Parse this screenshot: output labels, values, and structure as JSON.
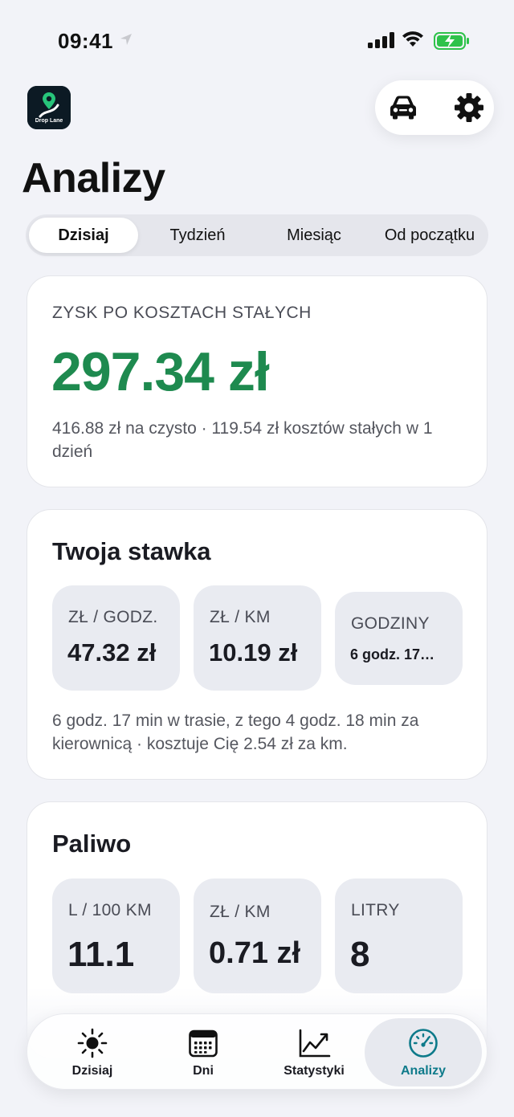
{
  "status_bar": {
    "time": "09:41"
  },
  "header": {
    "title": "Analizy"
  },
  "segments": [
    {
      "label": "Dzisiaj",
      "active": true
    },
    {
      "label": "Tydzień",
      "active": false
    },
    {
      "label": "Miesiąc",
      "active": false
    },
    {
      "label": "Od początku",
      "active": false
    }
  ],
  "profit": {
    "overline": "ZYSK PO KOSZTACH STAŁYCH",
    "value": "297.34 zł",
    "subtitle": "416.88 zł na czysto · 119.54 zł kosztów stałych w 1 dzień"
  },
  "rate": {
    "title": "Twoja stawka",
    "stats": [
      {
        "label": "ZŁ / GODZ.",
        "value": "47.32 zł"
      },
      {
        "label": "ZŁ / KM",
        "value": "10.19 zł"
      },
      {
        "label": "GODZINY",
        "value": "6 godz. 17…"
      }
    ],
    "subtitle": "6 godz. 17 min w trasie, z tego 4 godz. 18 min za kierownicą · kosztuje Cię 2.54 zł za km."
  },
  "fuel": {
    "title": "Paliwo",
    "stats": [
      {
        "label": "L / 100 KM",
        "value": "11.1"
      },
      {
        "label": "ZŁ / KM",
        "value": "0.71 zł"
      },
      {
        "label": "LITRY",
        "value": "8"
      }
    ]
  },
  "tabbar": {
    "tabs": [
      {
        "label": "Dzisiaj",
        "icon": "sun-icon",
        "active": false
      },
      {
        "label": "Dni",
        "icon": "calendar-icon",
        "active": false
      },
      {
        "label": "Statystyki",
        "icon": "chart-line-icon",
        "active": false
      },
      {
        "label": "Analizy",
        "icon": "speedometer-icon",
        "active": true
      }
    ]
  },
  "colors": {
    "profit_green": "#1e8a4f",
    "active_tab": "#0d7a8a",
    "background": "#f2f3f8"
  }
}
